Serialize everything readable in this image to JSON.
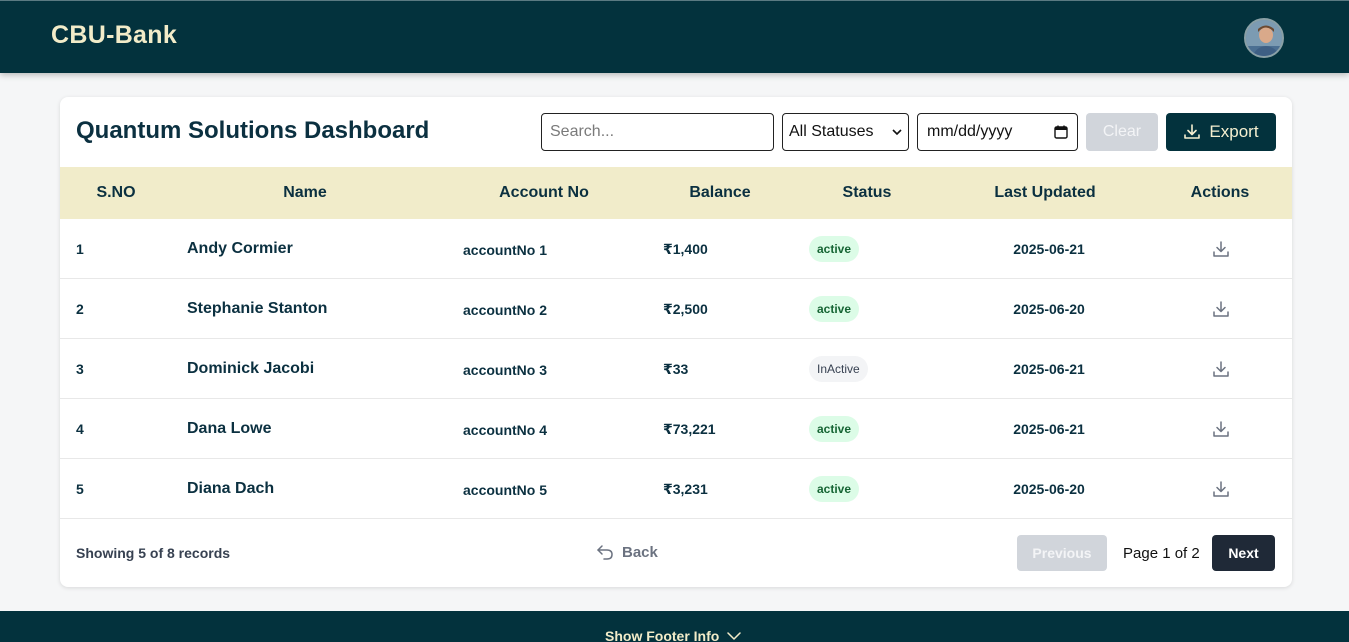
{
  "header": {
    "brand": "CBU-Bank",
    "avatar_icon": "user-avatar"
  },
  "dashboard": {
    "title": "Quantum Solutions Dashboard",
    "search_placeholder": "Search...",
    "status_filter": "All Statuses",
    "date_placeholder": "mm/dd/yyyy",
    "clear_label": "Clear",
    "export_label": "Export"
  },
  "table": {
    "columns": [
      "S.NO",
      "Name",
      "Account No",
      "Balance",
      "Status",
      "Last Updated",
      "Actions"
    ],
    "rows": [
      {
        "sno": "1",
        "name": "Andy Cormier",
        "account": "accountNo 1",
        "balance": "₹1,400",
        "status": "active",
        "date": "2025-06-21"
      },
      {
        "sno": "2",
        "name": "Stephanie Stanton",
        "account": "accountNo 2",
        "balance": "₹2,500",
        "status": "active",
        "date": "2025-06-20"
      },
      {
        "sno": "3",
        "name": "Dominick Jacobi",
        "account": "accountNo 3",
        "balance": "₹33",
        "status": "InActive",
        "date": "2025-06-21"
      },
      {
        "sno": "4",
        "name": "Dana Lowe",
        "account": "accountNo 4",
        "balance": "₹73,221",
        "status": "active",
        "date": "2025-06-21"
      },
      {
        "sno": "5",
        "name": "Diana Dach",
        "account": "accountNo 5",
        "balance": "₹3,231",
        "status": "active",
        "date": "2025-06-20"
      }
    ]
  },
  "pagination": {
    "records_text": "Showing 5 of 8 records",
    "back_label": "Back",
    "prev_label": "Previous",
    "page_text": "Page 1 of 2",
    "next_label": "Next"
  },
  "footer": {
    "toggle_label": "Show Footer Info"
  },
  "colors": {
    "primary": "#03323d",
    "accent": "#f2ecc9",
    "header_row": "#f1ecca",
    "active_badge": "#dcfce7",
    "inactive_badge": "#f3f4f6"
  }
}
